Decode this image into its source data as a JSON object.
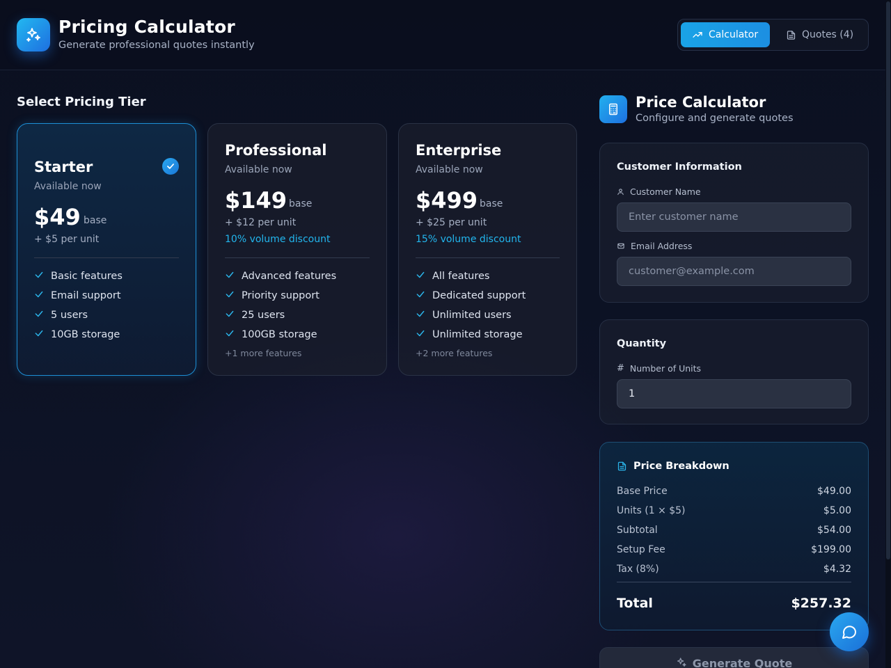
{
  "header": {
    "title": "Pricing Calculator",
    "subtitle": "Generate professional quotes instantly",
    "logo_icon": "sparkles-icon",
    "nav": [
      {
        "label": "Calculator",
        "icon": "trending-up-icon",
        "active": true
      },
      {
        "label": "Quotes (4)",
        "icon": "document-icon",
        "active": false
      }
    ]
  },
  "tiers_section": {
    "title": "Select Pricing Tier",
    "tiers": [
      {
        "name": "Starter",
        "availability": "Available now",
        "price": "$49",
        "base_label": "base",
        "per_unit": "+ $5 per unit",
        "discount": "",
        "features": [
          "Basic features",
          "Email support",
          "5 users",
          "10GB storage"
        ],
        "more": "",
        "selected": true
      },
      {
        "name": "Professional",
        "availability": "Available now",
        "price": "$149",
        "base_label": "base",
        "per_unit": "+ $12 per unit",
        "discount": "10% volume discount",
        "features": [
          "Advanced features",
          "Priority support",
          "25 users",
          "100GB storage"
        ],
        "more": "+1 more features",
        "selected": false
      },
      {
        "name": "Enterprise",
        "availability": "Available now",
        "price": "$499",
        "base_label": "base",
        "per_unit": "+ $25 per unit",
        "discount": "15% volume discount",
        "features": [
          "All features",
          "Dedicated support",
          "Unlimited users",
          "Unlimited storage"
        ],
        "more": "+2 more features",
        "selected": false
      }
    ]
  },
  "calculator": {
    "title": "Price Calculator",
    "subtitle": "Configure and generate quotes",
    "customer": {
      "title": "Customer Information",
      "name_label": "Customer Name",
      "name_placeholder": "Enter customer name",
      "name_value": "",
      "email_label": "Email Address",
      "email_placeholder": "customer@example.com",
      "email_value": ""
    },
    "quantity": {
      "title": "Quantity",
      "units_label": "Number of Units",
      "units_value": "1"
    },
    "breakdown": {
      "title": "Price Breakdown",
      "rows": [
        {
          "label": "Base Price",
          "value": "$49.00"
        },
        {
          "label": "Units (1 × $5)",
          "value": "$5.00"
        },
        {
          "label": "Subtotal",
          "value": "$54.00"
        },
        {
          "label": "Setup Fee",
          "value": "$199.00"
        },
        {
          "label": "Tax (8%)",
          "value": "$4.32"
        }
      ],
      "total_label": "Total",
      "total_value": "$257.32"
    },
    "generate_label": "Generate Quote"
  },
  "chat": {
    "icon": "chat-bubble-icon"
  },
  "colors": {
    "accent": "#1c9be6",
    "check": "#2bb5ea",
    "background": "#0c1224"
  }
}
